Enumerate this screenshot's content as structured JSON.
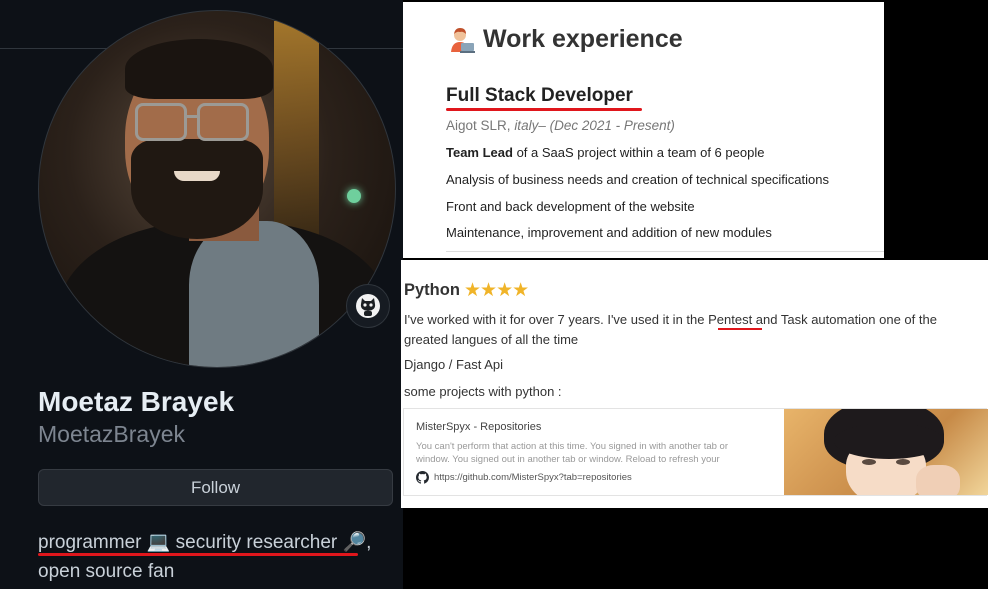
{
  "profile": {
    "display_name": "Moetaz Brayek",
    "username": "MoetazBrayek",
    "follow_label": "Follow",
    "bio_line1": "programmer 💻 security researcher 🔎,",
    "bio_line2": "open source fan",
    "colors": {
      "background": "#0d1117",
      "underline": "#e0161c"
    }
  },
  "work": {
    "title": "Work experience",
    "job_title": "Full Stack Developer",
    "company": "Aigot SLR,",
    "location_dates": "italy– (Dec 2021 - Present)",
    "duty_lead_bold": "Team Lead",
    "duty_lead_rest": " of a SaaS project within a team of 6 people",
    "duties": [
      "Analysis of business needs and creation of technical specifications",
      "Front and back development of the website",
      "Maintenance, improvement and addition of new modules"
    ]
  },
  "python": {
    "title": "Python",
    "stars": "★★★★",
    "description": "I've worked with it for over 7 years. I've used it in the  Pentest and Task automation one of the greated langues of all the time",
    "frameworks": "Django / Fast Api",
    "projects_label": "some projects with python :",
    "link_card": {
      "title": "MisterSpyx - Repositories",
      "description": "You can't perform that action at this time. You signed in with another tab or window. You signed out in another tab or window. Reload to refresh your",
      "url": "https://github.com/MisterSpyx?tab=repositories"
    }
  }
}
